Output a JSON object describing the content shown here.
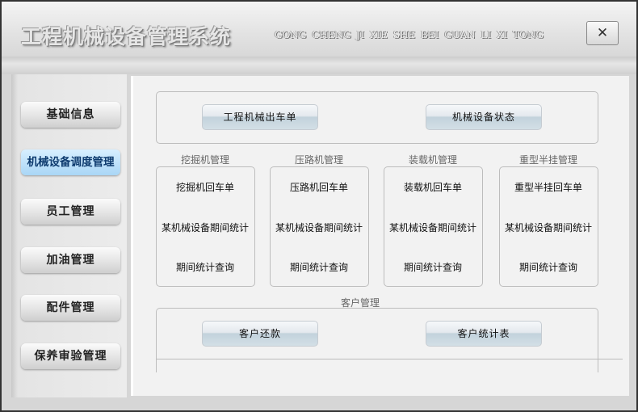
{
  "header": {
    "title": "工程机械设备管理系统",
    "subtitle": "GONG CHENG JI XIE SHE BEI GUAN LI XI TONG",
    "close_label": "✕"
  },
  "sidebar": {
    "items": [
      {
        "label": "基础信息"
      },
      {
        "label": "机械设备调度管理",
        "active": true
      },
      {
        "label": "员工管理"
      },
      {
        "label": "加油管理"
      },
      {
        "label": "配件管理"
      },
      {
        "label": "保养审验管理"
      }
    ]
  },
  "main": {
    "top_buttons": [
      "工程机械出车单",
      "机械设备状态"
    ],
    "groups": [
      {
        "title": "挖掘机管理",
        "items": [
          "挖掘机回车单",
          "某机械设备期间统计",
          "期间统计查询"
        ]
      },
      {
        "title": "压路机管理",
        "items": [
          "压路机回车单",
          "某机械设备期间统计",
          "期间统计查询"
        ]
      },
      {
        "title": "装载机管理",
        "items": [
          "装载机回车单",
          "某机械设备期间统计",
          "期间统计查询"
        ]
      },
      {
        "title": "重型半挂管理",
        "items": [
          "重型半挂回车单",
          "某机械设备期间统计",
          "期间统计查询"
        ]
      }
    ],
    "customer": {
      "title": "客户管理",
      "buttons": [
        "客户还款",
        "客户统计表"
      ]
    }
  }
}
